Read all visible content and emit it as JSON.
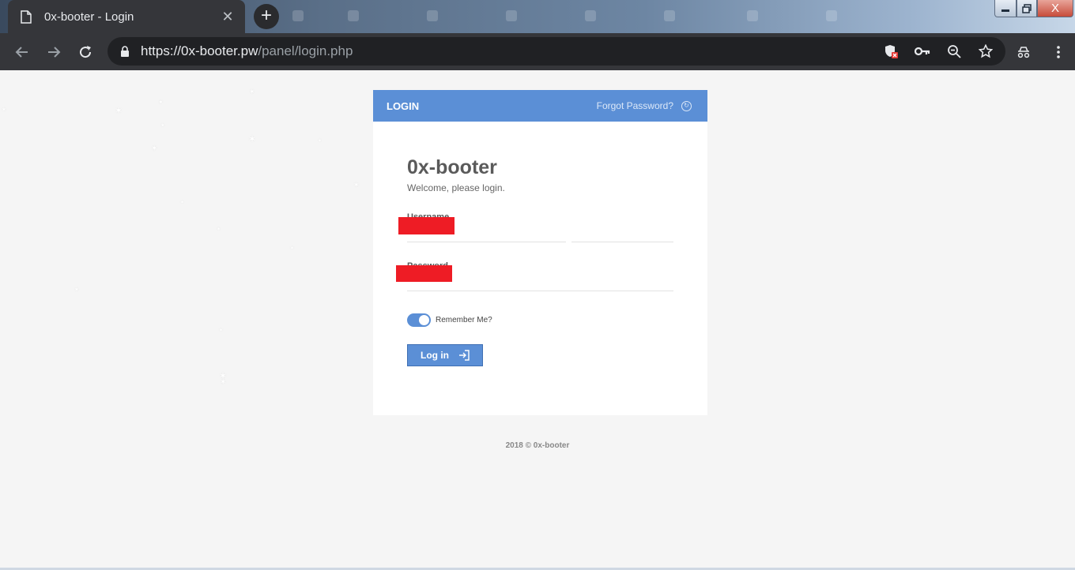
{
  "browser": {
    "tab_title": "0x-booter - Login",
    "new_tab_symbol": "+",
    "close_symbol": "✕",
    "url_host": "https://0x-booter.pw",
    "url_path": "/panel/login.php",
    "window_controls": {
      "close_symbol": "X"
    }
  },
  "card": {
    "header_title": "LOGIN",
    "forgot_label": "Forgot Password?",
    "brand": "0x-booter",
    "welcome": "Welcome, please login.",
    "username_label": "Username",
    "password_label": "Password",
    "remember_label": "Remember Me?",
    "remember_on": true,
    "login_button": "Log in"
  },
  "footer": {
    "text": "2018 © 0x-booter"
  },
  "colors": {
    "accent": "#5b8fd6",
    "redaction": "#ee1c25",
    "page_bg": "#f5f5f5",
    "chrome_dark": "#35363a"
  },
  "icons": {
    "tab": "document-icon",
    "back": "arrow-left-icon",
    "forward": "arrow-right-icon",
    "reload": "reload-icon",
    "lock": "lock-icon",
    "shield": "shield-blocked-icon",
    "key": "key-icon",
    "zoom": "zoom-out-icon",
    "bookmark": "star-icon",
    "extension": "incognito-extension-icon",
    "menu": "kebab-menu-icon",
    "forgot": "circle-arrow-icon",
    "login": "sign-in-icon"
  }
}
